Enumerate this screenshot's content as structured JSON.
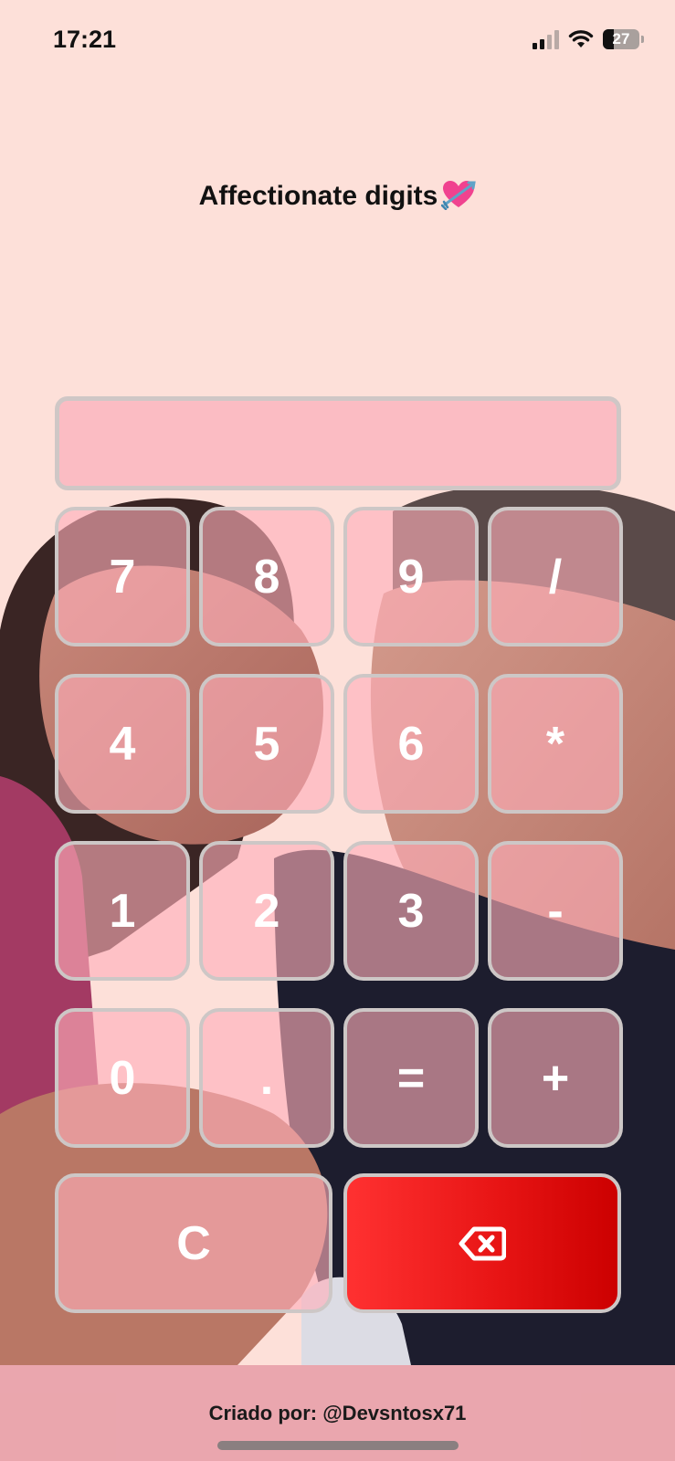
{
  "status_bar": {
    "time": "17:21",
    "battery_level": "27"
  },
  "app": {
    "title": "Affectionate digits",
    "title_icon": "heart-with-arrow-icon"
  },
  "display": {
    "value": ""
  },
  "keypad": {
    "rows": [
      [
        "7",
        "8",
        "9",
        "/"
      ],
      [
        "4",
        "5",
        "6",
        "*"
      ],
      [
        "1",
        "2",
        "3",
        "-"
      ],
      [
        "0",
        ".",
        "=",
        "+"
      ]
    ],
    "clear_label": "C",
    "backspace_icon": "backspace-icon"
  },
  "footer": {
    "credit": "Criado por: @Devsntosx71"
  },
  "colors": {
    "background": "#fde0d9",
    "key_fill": "#ffafb9",
    "key_border": "#cdc7c6",
    "backspace_key": "#e81515",
    "footer": "#e8a0a8"
  }
}
